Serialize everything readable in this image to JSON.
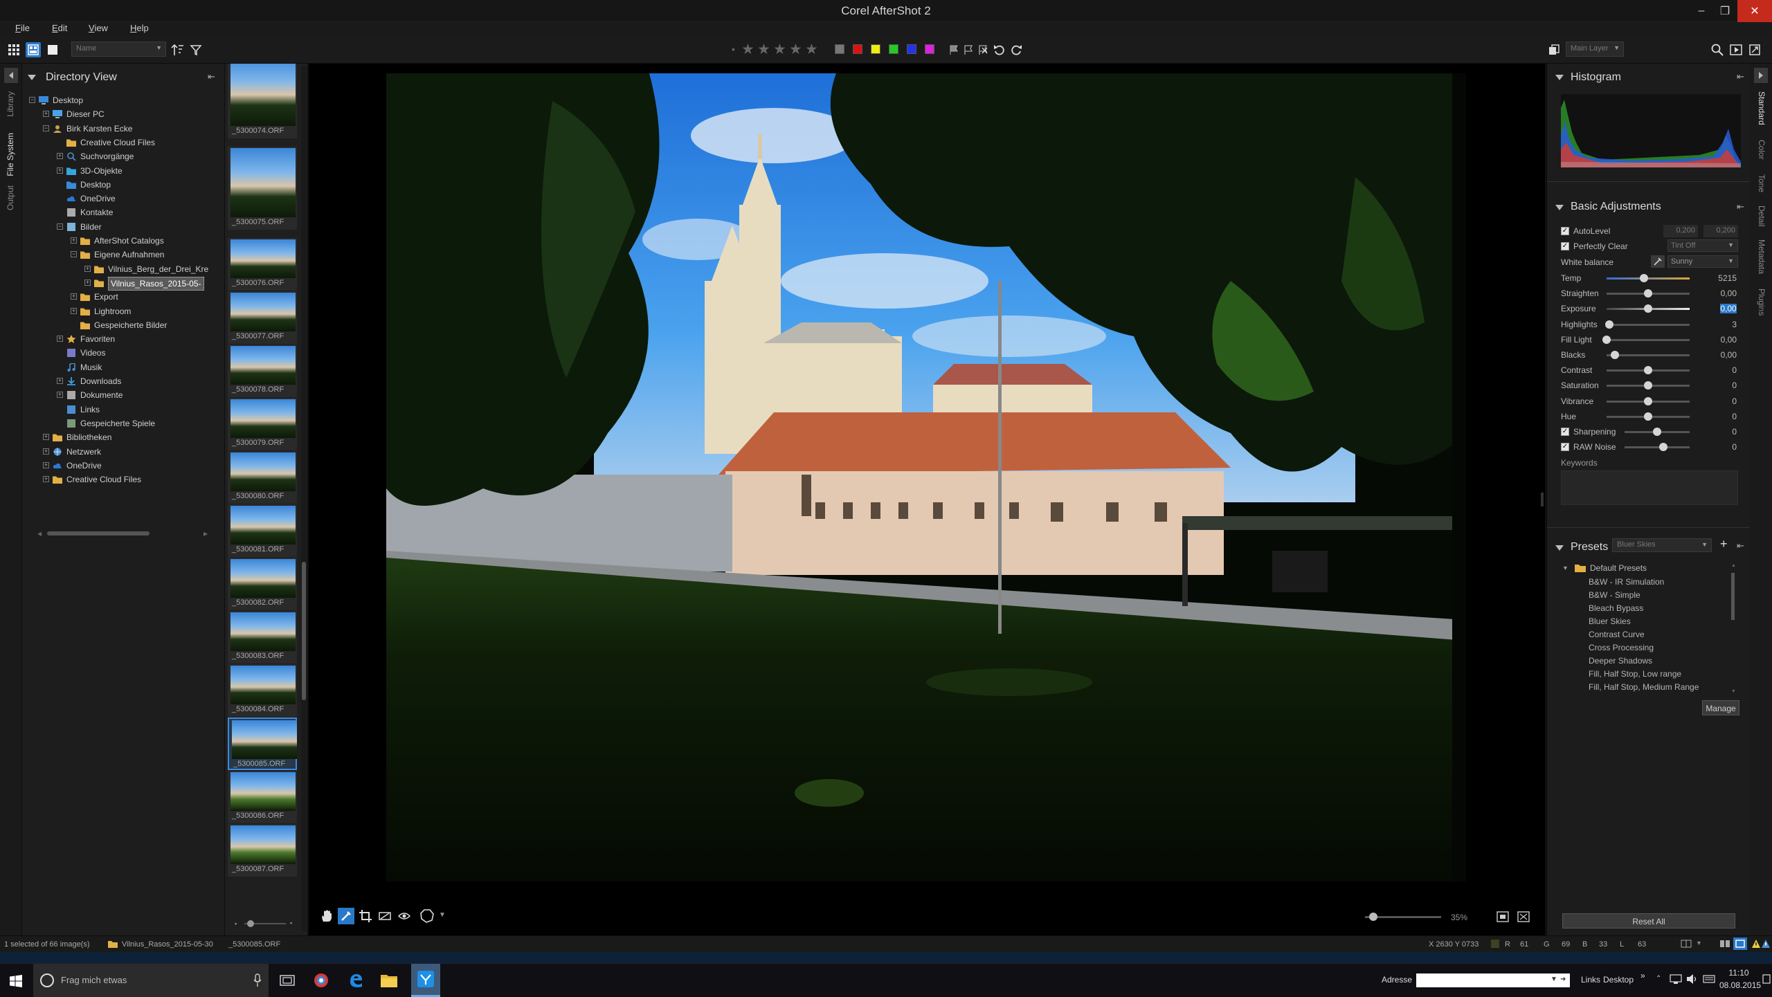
{
  "window": {
    "title": "Corel AfterShot 2",
    "minimize": "‒",
    "maximize": "❐",
    "close": "✕"
  },
  "menu": [
    {
      "label": "File",
      "u": "F",
      "rest": "ile"
    },
    {
      "label": "Edit",
      "u": "E",
      "rest": "dit"
    },
    {
      "label": "View",
      "u": "V",
      "rest": "iew"
    },
    {
      "label": "Help",
      "u": "H",
      "rest": "elp"
    }
  ],
  "toolbar": {
    "sort_dropdown": "Name",
    "layer_dropdown": "Main Layer",
    "rating_dot": "•",
    "stars": [
      "★",
      "★",
      "★",
      "★",
      "★"
    ],
    "color_labels": [
      "#777777",
      "#dd1111",
      "#eeee11",
      "#22cc22",
      "#2233ee",
      "#dd22dd"
    ]
  },
  "left_tabs": [
    "Library",
    "File System",
    "Output"
  ],
  "directory": {
    "title": "Directory View",
    "pin": "⇤",
    "items": [
      {
        "label": "Desktop",
        "level": 0,
        "exp": "−",
        "icon": "desktop",
        "color": "#3a8ad8"
      },
      {
        "label": "Dieser PC",
        "level": 1,
        "exp": "+",
        "icon": "pc",
        "color": "#4aa3e8"
      },
      {
        "label": "Birk Karsten Ecke",
        "level": 1,
        "exp": "−",
        "icon": "user",
        "color": "#c8a050"
      },
      {
        "label": "Creative Cloud Files",
        "level": 2,
        "exp": "",
        "icon": "folder",
        "color": "#e2b046"
      },
      {
        "label": "Suchvorgänge",
        "level": 2,
        "exp": "+",
        "icon": "search",
        "color": "#4a8ed0"
      },
      {
        "label": "3D-Objekte",
        "level": 2,
        "exp": "+",
        "icon": "folder",
        "color": "#39a5dc"
      },
      {
        "label": "Desktop",
        "level": 2,
        "exp": "",
        "icon": "folder",
        "color": "#3a8ad8"
      },
      {
        "label": "OneDrive",
        "level": 2,
        "exp": "",
        "icon": "cloud",
        "color": "#2a7ad0"
      },
      {
        "label": "Kontakte",
        "level": 2,
        "exp": "",
        "icon": "contacts",
        "color": "#aaaaaa"
      },
      {
        "label": "Bilder",
        "level": 2,
        "exp": "−",
        "icon": "pictures",
        "color": "#7fb3d9"
      },
      {
        "label": "AfterShot Catalogs",
        "level": 3,
        "exp": "+",
        "icon": "folder",
        "color": "#e2b046"
      },
      {
        "label": "Eigene Aufnahmen",
        "level": 3,
        "exp": "−",
        "icon": "folder",
        "color": "#e2b046"
      },
      {
        "label": "Vilnius_Berg_der_Drei_Kre",
        "level": 4,
        "exp": "+",
        "icon": "folder",
        "color": "#e2b046"
      },
      {
        "label": "Vilnius_Rasos_2015-05-",
        "level": 4,
        "exp": "+",
        "icon": "folder",
        "color": "#e2b046",
        "selected": true
      },
      {
        "label": "Export",
        "level": 3,
        "exp": "+",
        "icon": "folder",
        "color": "#e2b046"
      },
      {
        "label": "Lightroom",
        "level": 3,
        "exp": "+",
        "icon": "folder",
        "color": "#e2b046"
      },
      {
        "label": "Gespeicherte Bilder",
        "level": 3,
        "exp": "",
        "icon": "folder",
        "color": "#e2b046"
      },
      {
        "label": "Favoriten",
        "level": 2,
        "exp": "+",
        "icon": "star",
        "color": "#e2b046"
      },
      {
        "label": "Videos",
        "level": 2,
        "exp": "",
        "icon": "video",
        "color": "#7a7acc"
      },
      {
        "label": "Musik",
        "level": 2,
        "exp": "",
        "icon": "music",
        "color": "#4a8ed0"
      },
      {
        "label": "Downloads",
        "level": 2,
        "exp": "+",
        "icon": "download",
        "color": "#3aa0e0"
      },
      {
        "label": "Dokumente",
        "level": 2,
        "exp": "+",
        "icon": "doc",
        "color": "#aaaaaa"
      },
      {
        "label": "Links",
        "level": 2,
        "exp": "",
        "icon": "link",
        "color": "#4a8ed0"
      },
      {
        "label": "Gespeicherte Spiele",
        "level": 2,
        "exp": "",
        "icon": "game",
        "color": "#7a9a7a"
      },
      {
        "label": "Bibliotheken",
        "level": 1,
        "exp": "+",
        "icon": "folder",
        "color": "#e2b046"
      },
      {
        "label": "Netzwerk",
        "level": 1,
        "exp": "+",
        "icon": "network",
        "color": "#4a8ed0"
      },
      {
        "label": "OneDrive",
        "level": 1,
        "exp": "+",
        "icon": "cloud",
        "color": "#2a7ad0"
      },
      {
        "label": "Creative Cloud Files",
        "level": 1,
        "exp": "+",
        "icon": "folder",
        "color": "#e2b046"
      }
    ]
  },
  "filmstrip": [
    {
      "label": "_5300074.ORF"
    },
    {
      "label": "_5300075.ORF"
    },
    {
      "label": "_5300076.ORF"
    },
    {
      "label": "_5300077.ORF"
    },
    {
      "label": "_5300078.ORF"
    },
    {
      "label": "_5300079.ORF"
    },
    {
      "label": "_5300080.ORF"
    },
    {
      "label": "_5300081.ORF"
    },
    {
      "label": "_5300082.ORF"
    },
    {
      "label": "_5300083.ORF"
    },
    {
      "label": "_5300084.ORF"
    },
    {
      "label": "_5300085.ORF",
      "selected": true
    },
    {
      "label": "_5300086.ORF"
    },
    {
      "label": "_5300087.ORF"
    }
  ],
  "viewer": {
    "zoom": "35%"
  },
  "histogram": {
    "title": "Histogram"
  },
  "basic": {
    "title": "Basic Adjustments",
    "autolevel": {
      "label": "AutoLevel",
      "v1": "0,200",
      "v2": "0,200"
    },
    "perfectly_clear": {
      "label": "Perfectly Clear",
      "value": "Tint Off"
    },
    "white_balance": {
      "label": "White balance",
      "value": "Sunny"
    },
    "sliders": [
      {
        "label": "Temp",
        "value": "5215",
        "pos": 0.45,
        "check": false
      },
      {
        "label": "Straighten",
        "value": "0,00",
        "pos": 0.5,
        "check": false
      },
      {
        "label": "Exposure",
        "value": "0,00",
        "pos": 0.5,
        "check": false,
        "highlight": true
      },
      {
        "label": "Highlights",
        "value": "3",
        "pos": 0.03,
        "check": false
      },
      {
        "label": "Fill Light",
        "value": "0,00",
        "pos": 0.0,
        "check": false
      },
      {
        "label": "Blacks",
        "value": "0,00",
        "pos": 0.1,
        "check": false
      },
      {
        "label": "Contrast",
        "value": "0",
        "pos": 0.5,
        "check": false
      },
      {
        "label": "Saturation",
        "value": "0",
        "pos": 0.5,
        "check": false
      },
      {
        "label": "Vibrance",
        "value": "0",
        "pos": 0.5,
        "check": false
      },
      {
        "label": "Hue",
        "value": "0",
        "pos": 0.5,
        "check": false
      },
      {
        "label": "Sharpening",
        "value": "0",
        "pos": 0.5,
        "check": true
      },
      {
        "label": "RAW Noise",
        "value": "0",
        "pos": 0.6,
        "check": true
      }
    ],
    "keywords": "Keywords"
  },
  "presets": {
    "title": "Presets",
    "dropdown": "Bluer Skies",
    "group": "Default Presets",
    "items": [
      "B&W - IR Simulation",
      "B&W - Simple",
      "Bleach Bypass",
      "Bluer Skies",
      "Contrast Curve",
      "Cross Processing",
      "Deeper Shadows",
      "Fill, Half Stop, Low range",
      "Fill, Half Stop, Medium Range"
    ],
    "manage": "Manage",
    "reset": "Reset All"
  },
  "right_tabs": [
    "Standard",
    "Color",
    "Tone",
    "Detail",
    "Metadata",
    "Plugins"
  ],
  "status": {
    "selection": "1 selected of 66 image(s)",
    "folder": "Vilnius_Rasos_2015-05-30",
    "file": "_5300085.ORF",
    "coords": "X 2630  Y 0733",
    "r_label": "R",
    "r": "61",
    "g_label": "G",
    "g": "69",
    "b_label": "B",
    "b": "33",
    "l_label": "L",
    "l": "63"
  },
  "taskbar": {
    "search": "Frag mich etwas",
    "address_label": "Adresse",
    "links": "Links",
    "desktop": "Desktop",
    "time": "11:10",
    "date": "08.08.2015"
  }
}
